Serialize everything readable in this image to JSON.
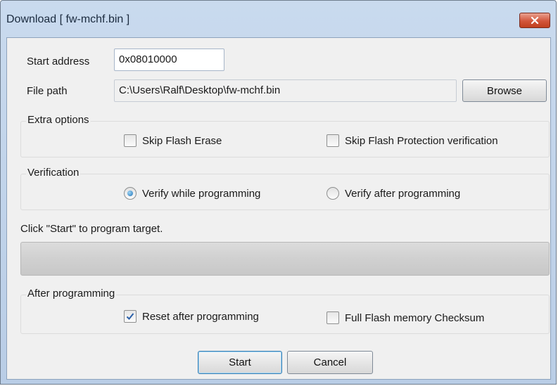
{
  "window": {
    "title": "Download [ fw-mchf.bin ]",
    "close_icon": "close-icon"
  },
  "start_address": {
    "label": "Start address",
    "value": "0x08010000"
  },
  "file_path": {
    "label": "File path",
    "value": "C:\\Users\\Ralf\\Desktop\\fw-mchf.bin",
    "browse_label": "Browse"
  },
  "extra_options": {
    "title": "Extra options",
    "skip_flash_erase": {
      "label": "Skip Flash Erase",
      "checked": false
    },
    "skip_flash_protection": {
      "label": "Skip Flash Protection verification",
      "checked": false
    }
  },
  "verification": {
    "title": "Verification",
    "verify_while": {
      "label": "Verify while programming",
      "selected": true
    },
    "verify_after": {
      "label": "Verify after programming",
      "selected": false
    }
  },
  "status": {
    "text": "Click \"Start\" to program target.",
    "progress": 0
  },
  "after_programming": {
    "title": "After programming",
    "reset_after": {
      "label": "Reset after programming",
      "checked": true
    },
    "full_checksum": {
      "label": "Full Flash memory Checksum",
      "checked": false
    }
  },
  "buttons": {
    "start_label": "Start",
    "cancel_label": "Cancel"
  },
  "colors": {
    "close_button": "#d2553b",
    "radio_dot": "#1f73b8",
    "check_mark": "#2a5fa8"
  }
}
